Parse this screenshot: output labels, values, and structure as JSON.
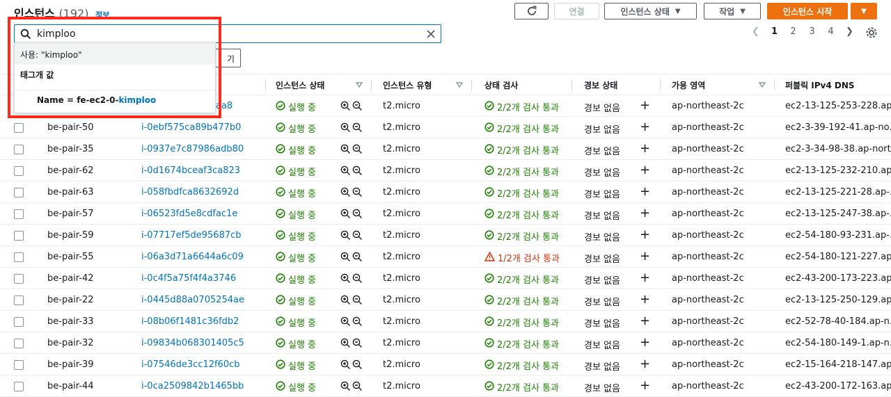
{
  "header": {
    "title": "인스턴스",
    "count": "(192)",
    "info": "정보",
    "connect": "연결",
    "instance_state": "인스턴스 상태",
    "actions": "작업",
    "launch": "인스턴스 시작"
  },
  "search": {
    "value": "kimploo"
  },
  "dropdown": {
    "use_text": "사용: \"kimploo\"",
    "group_label": "태그개 값",
    "option_prefix": "Name = fe-ec2-0-",
    "option_highlight": "kimploo"
  },
  "partial_button": "기",
  "pagination": {
    "pages": [
      "1",
      "2",
      "3",
      "4"
    ],
    "current": "1"
  },
  "columns": {
    "state": "인스턴스 상태",
    "type": "인스턴스 유형",
    "check": "상태 검사",
    "alarm": "경보 상태",
    "az": "가용 영역",
    "dns": "퍼블릭 IPv4 DNS"
  },
  "rows": [
    {
      "name": "",
      "id": "aa8",
      "state": "실행 중",
      "type": "t2.micro",
      "check": "2/2개 검사 통과",
      "check_status": "ok",
      "alarm": "경보 없음",
      "az": "ap-northeast-2c",
      "dns": "ec2-13-125-253-228.ap..."
    },
    {
      "name": "be-pair-50",
      "id": "i-0ebf575ca89b477b0",
      "state": "실행 중",
      "type": "t2.micro",
      "check": "2/2개 검사 통과",
      "check_status": "ok",
      "alarm": "경보 없음",
      "az": "ap-northeast-2c",
      "dns": "ec2-3-39-192-41.ap-no..."
    },
    {
      "name": "be-pair-35",
      "id": "i-0937e7c87986adb80",
      "state": "실행 중",
      "type": "t2.micro",
      "check": "2/2개 검사 통과",
      "check_status": "ok",
      "alarm": "경보 없음",
      "az": "ap-northeast-2c",
      "dns": "ec2-3-34-98-38.ap-nort..."
    },
    {
      "name": "be-pair-62",
      "id": "i-0d1674bceaf3ca823",
      "state": "실행 중",
      "type": "t2.micro",
      "check": "2/2개 검사 통과",
      "check_status": "ok",
      "alarm": "경보 없음",
      "az": "ap-northeast-2c",
      "dns": "ec2-13-125-232-210.ap..."
    },
    {
      "name": "be-pair-63",
      "id": "i-058fbdfca8632692d",
      "state": "실행 중",
      "type": "t2.micro",
      "check": "2/2개 검사 통과",
      "check_status": "ok",
      "alarm": "경보 없음",
      "az": "ap-northeast-2c",
      "dns": "ec2-13-125-221-28.ap-..."
    },
    {
      "name": "be-pair-57",
      "id": "i-06523fd5e8cdfac1e",
      "state": "실행 중",
      "type": "t2.micro",
      "check": "2/2개 검사 통과",
      "check_status": "ok",
      "alarm": "경보 없음",
      "az": "ap-northeast-2c",
      "dns": "ec2-13-125-247-38.ap-..."
    },
    {
      "name": "be-pair-59",
      "id": "i-07717ef5de95687cb",
      "state": "실행 중",
      "type": "t2.micro",
      "check": "2/2개 검사 통과",
      "check_status": "ok",
      "alarm": "경보 없음",
      "az": "ap-northeast-2c",
      "dns": "ec2-54-180-93-231.ap-..."
    },
    {
      "name": "be-pair-55",
      "id": "i-06a3d71a6644a6c09",
      "state": "실행 중",
      "type": "t2.micro",
      "check": "1/2개 검사 통과",
      "check_status": "warn",
      "alarm": "경보 없음",
      "az": "ap-northeast-2c",
      "dns": "ec2-54-180-121-227.ap..."
    },
    {
      "name": "be-pair-42",
      "id": "i-0c4f5a75f4f4a3746",
      "state": "실행 중",
      "type": "t2.micro",
      "check": "2/2개 검사 통과",
      "check_status": "ok",
      "alarm": "경보 없음",
      "az": "ap-northeast-2c",
      "dns": "ec2-43-200-173-223.ap..."
    },
    {
      "name": "be-pair-22",
      "id": "i-0445d88a0705254ae",
      "state": "실행 중",
      "type": "t2.micro",
      "check": "2/2개 검사 통과",
      "check_status": "ok",
      "alarm": "경보 없음",
      "az": "ap-northeast-2c",
      "dns": "ec2-13-125-250-129.ap..."
    },
    {
      "name": "be-pair-33",
      "id": "i-08b06f1481c36fdb2",
      "state": "실행 중",
      "type": "t2.micro",
      "check": "2/2개 검사 통과",
      "check_status": "ok",
      "alarm": "경보 없음",
      "az": "ap-northeast-2c",
      "dns": "ec2-52-78-40-184.ap-n..."
    },
    {
      "name": "be-pair-32",
      "id": "i-09834b068301405c5",
      "state": "실행 중",
      "type": "t2.micro",
      "check": "2/2개 검사 통과",
      "check_status": "ok",
      "alarm": "경보 없음",
      "az": "ap-northeast-2c",
      "dns": "ec2-54-180-149-1.ap-n..."
    },
    {
      "name": "be-pair-39",
      "id": "i-07546de3cc12f60cb",
      "state": "실행 중",
      "type": "t2.micro",
      "check": "2/2개 검사 통과",
      "check_status": "ok",
      "alarm": "경보 없음",
      "az": "ap-northeast-2c",
      "dns": "ec2-15-164-218-147.ap..."
    },
    {
      "name": "be-pair-44",
      "id": "i-0ca2509842b1465bb",
      "state": "실행 중",
      "type": "t2.micro",
      "check": "2/2개 검사 통과",
      "check_status": "ok",
      "alarm": "경보 없음",
      "az": "ap-northeast-2c",
      "dns": "ec2-43-200-172-163.ap..."
    }
  ],
  "colors": {
    "link": "#0073bb",
    "ok": "#1d8102",
    "warn": "#d13212",
    "primary": "#ec7211",
    "highlight_box": "#ff2a1d"
  }
}
